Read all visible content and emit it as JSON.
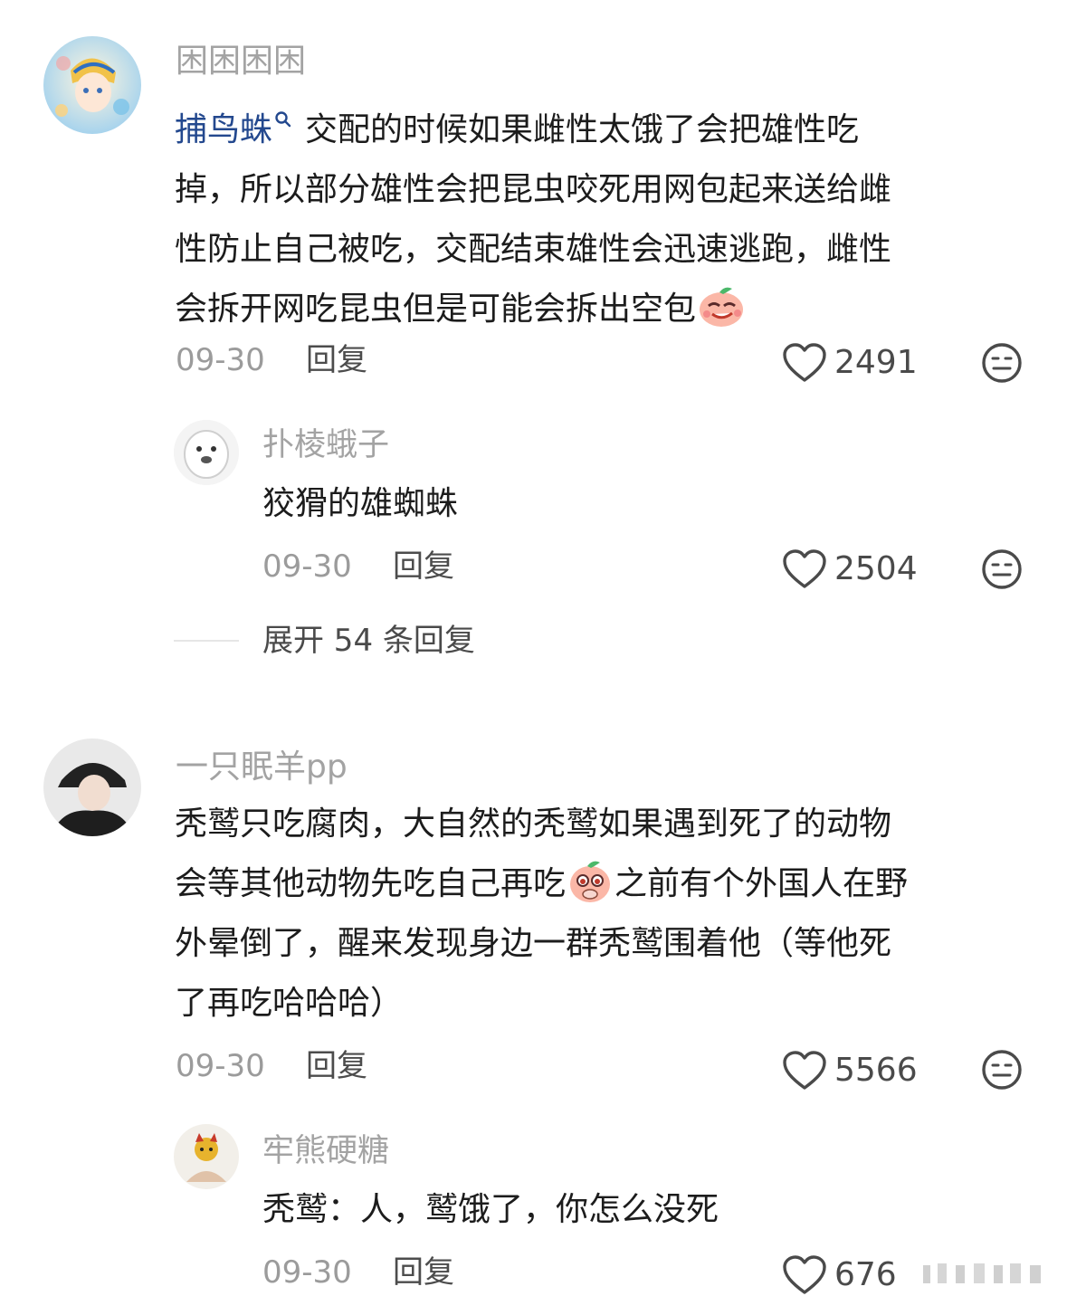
{
  "comments": [
    {
      "username": "困困困困",
      "keyword": "捕鸟蛛",
      "text_line1": "交配的时候如果雌性太饿了会把雄性吃",
      "text_lines": [
        "掉，所以部分雄性会把昆虫咬死用网包起来送给雌",
        "性防止自己被吃，交配结束雄性会迅速逃跑，雌性"
      ],
      "text_last": "会拆开网吃昆虫但是可能会拆出空包",
      "date": "09-30",
      "reply_label": "回复",
      "likes": "2491",
      "replies": [
        {
          "username": "扑棱蛾子",
          "text": "狡猾的雄蜘蛛",
          "date": "09-30",
          "reply_label": "回复",
          "likes": "2504"
        }
      ],
      "expand_label": "展开 54 条回复"
    },
    {
      "username": "一只眠羊pp",
      "text_line1": "秃鹫只吃腐肉，大自然的秃鹫如果遇到死了的动物",
      "text_line2a": "会等其他动物先吃自己再吃",
      "text_line2b": "之前有个外国人在野",
      "text_line3": "外晕倒了，醒来发现身边一群秃鹫围着他（等他死",
      "text_line4": "了再吃哈哈哈）",
      "date": "09-30",
      "reply_label": "回复",
      "likes": "5566",
      "replies": [
        {
          "username": "牢熊硬糖",
          "text": "秃鹫：人，鹫饿了，你怎么没死",
          "date": "09-30",
          "reply_label": "回复",
          "likes": "676"
        }
      ]
    }
  ],
  "icons": {
    "like": "heart-outline-icon",
    "reaction": "meh-face-icon",
    "keyword_search": "search-icon",
    "emoji_1": "smirk-peach-emoji",
    "emoji_2": "pleading-peach-emoji"
  },
  "colors": {
    "keyword": "#23488e",
    "username": "#a3a3a3",
    "meta": "#9b9b9b"
  }
}
